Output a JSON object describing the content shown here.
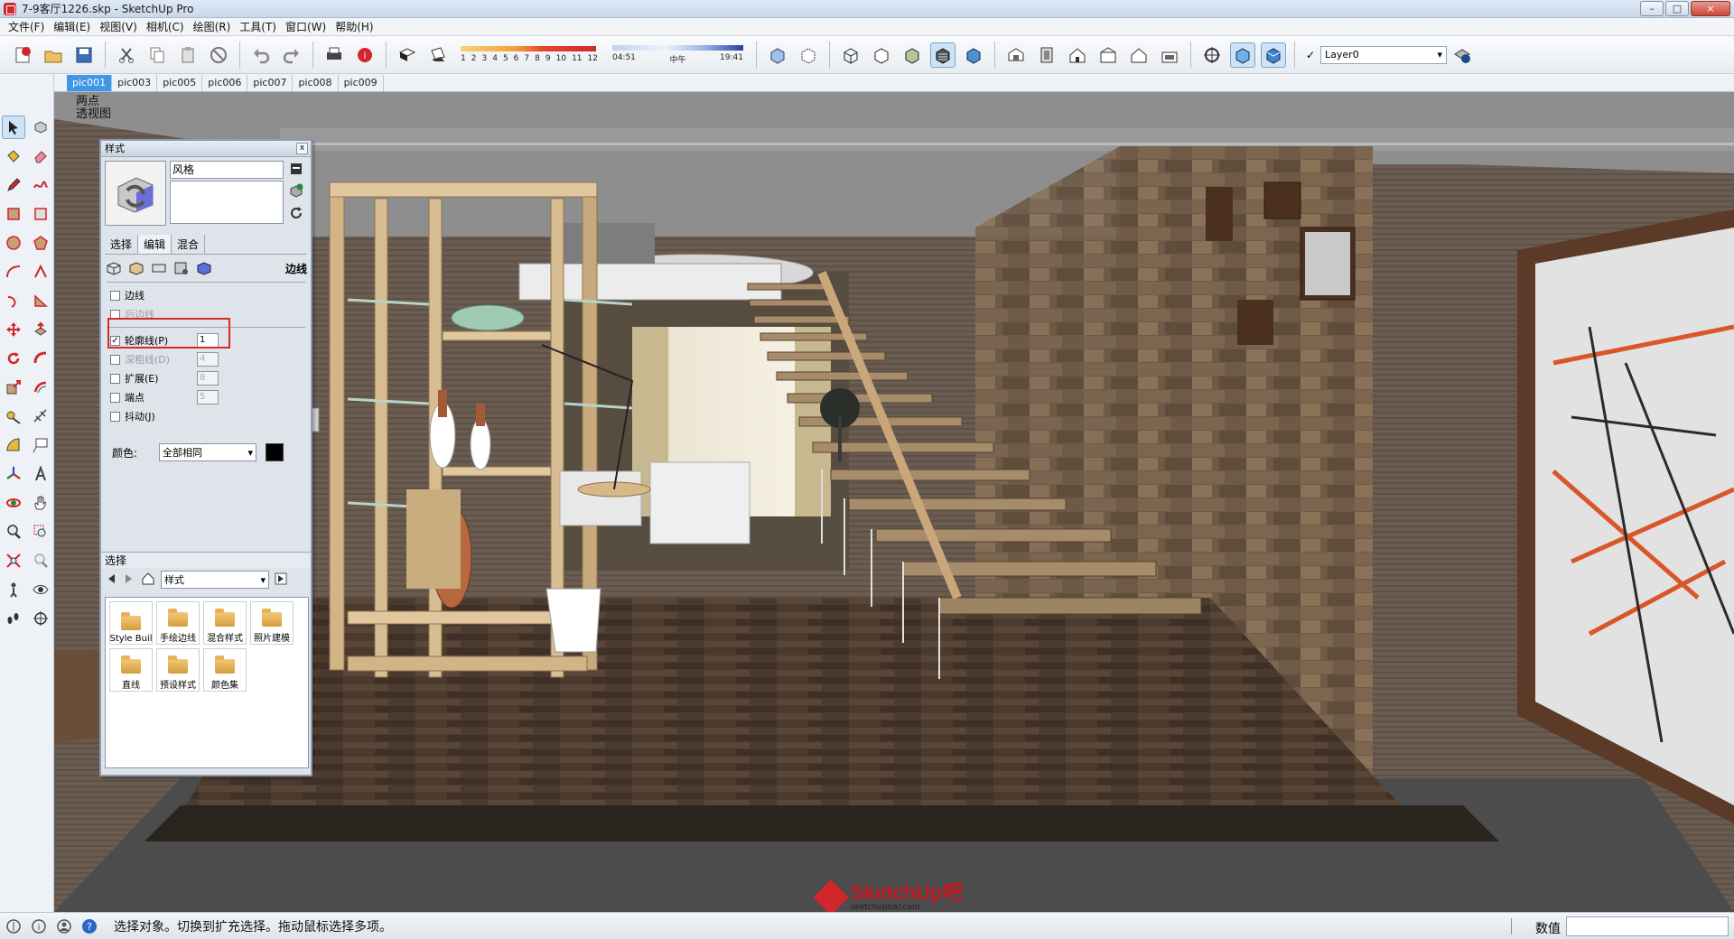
{
  "window": {
    "title": "7-9客厅1226.skp - SketchUp Pro",
    "controls": {
      "minimize": "–",
      "maximize": "□",
      "close": "×"
    }
  },
  "menu": [
    "文件(F)",
    "编辑(E)",
    "视图(V)",
    "相机(C)",
    "绘图(R)",
    "工具(T)",
    "窗口(W)",
    "帮助(H)"
  ],
  "toolbar": {
    "shadow_scale_numbers": [
      "1",
      "2",
      "3",
      "4",
      "5",
      "6",
      "7",
      "8",
      "9",
      "10",
      "11",
      "12"
    ],
    "time_labels": {
      "start": "04:51",
      "mid": "中午",
      "end": "19:41"
    },
    "layer": {
      "checked": true,
      "check_glyph": "✓",
      "value": "Layer0"
    },
    "dropdown_arrow": "▾"
  },
  "scenes": {
    "tabs": [
      "pic001",
      "pic003",
      "pic005",
      "pic006",
      "pic007",
      "pic008",
      "pic009"
    ],
    "active": "pic001"
  },
  "viewport": {
    "view_label_line1": "两点",
    "view_label_line2": "透视图",
    "watermark_main": "SketchUp吧",
    "watermark_sub": "sketchupbar.com"
  },
  "styles_panel": {
    "title": "样式",
    "close": "x",
    "style_name": "风格",
    "tabs": [
      "选择",
      "编辑",
      "混合"
    ],
    "active_tab": "编辑",
    "section_label": "边线",
    "edge_settings": [
      {
        "label": "边线",
        "checked": false,
        "disabled": false,
        "value": ""
      },
      {
        "label": "后边线",
        "checked": false,
        "disabled": true,
        "value": ""
      },
      {
        "label": "轮廓线(P)",
        "checked": true,
        "disabled": false,
        "value": "1"
      },
      {
        "label": "深粗线(D)",
        "checked": false,
        "disabled": true,
        "value": "4"
      },
      {
        "label": "扩展(E)",
        "checked": false,
        "disabled": false,
        "value": "8"
      },
      {
        "label": "端点",
        "checked": false,
        "disabled": false,
        "value": "5"
      },
      {
        "label": "抖动(J)",
        "checked": false,
        "disabled": false,
        "value": ""
      }
    ],
    "check_glyph": "✓",
    "color_label": "颜色:",
    "color_value": "全部相同",
    "color_swatch": "#000000",
    "select_header": "选择",
    "library_value": "样式",
    "library_items": [
      "Style Buil",
      "手绘边线",
      "混合样式",
      "照片建模",
      "直线",
      "预设样式",
      "颜色集"
    ]
  },
  "status": {
    "message": "选择对象。切换到扩充选择。拖动鼠标选择多项。",
    "value_label": "数值"
  },
  "colors": {
    "accent": "#3f97e6",
    "highlight_box": "#d72a26",
    "sketchup_red": "#d1262c"
  }
}
